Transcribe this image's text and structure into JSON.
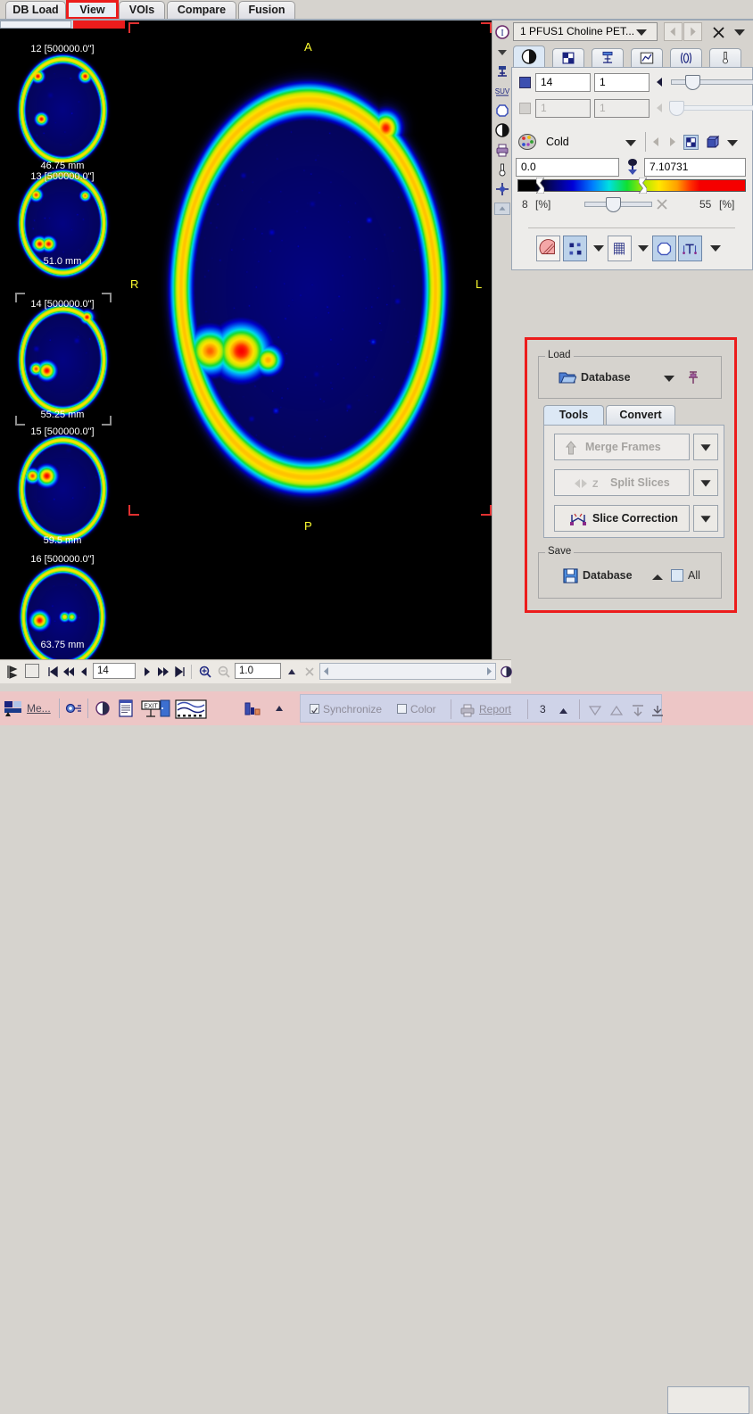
{
  "tabs": [
    {
      "label": "DB Load",
      "selected": false
    },
    {
      "label": "View",
      "selected": true,
      "highlighted": true
    },
    {
      "label": "VOIs",
      "selected": false
    },
    {
      "label": "Compare",
      "selected": false
    },
    {
      "label": "Fusion",
      "selected": false
    }
  ],
  "thumbnails": [
    {
      "index": "12 [500000.0\"]",
      "position": "46.75 mm"
    },
    {
      "index": "13 [500000.0\"]",
      "position": "51.0 mm"
    },
    {
      "index": "14 [500000.0\"]",
      "position": "55.25 mm",
      "selected": true
    },
    {
      "index": "15 [500000.0\"]",
      "position": "59.5 mm"
    },
    {
      "index": "16 [500000.0\"]",
      "position": "63.75 mm"
    }
  ],
  "main_view": {
    "orientation": {
      "top": "A",
      "left": "R",
      "right": "L",
      "bottom": "P"
    }
  },
  "series": {
    "name": "1 PFUS1 Choline PET...",
    "dropdown_icon": "chevron-down-icon",
    "prev_icon": "triangle-left-icon",
    "next_icon": "triangle-right-icon",
    "close_icon": "close-x-icon",
    "menu_icon": "chevron-down-icon"
  },
  "control_tabs": [
    {
      "name": "contrast-tab",
      "icon": "contrast-circle-icon",
      "selected": true
    },
    {
      "name": "layout-tab",
      "icon": "grid-layout-icon",
      "selected": false
    },
    {
      "name": "isocontour-tab",
      "icon": "isocontour-icon",
      "selected": false
    },
    {
      "name": "curve-tab",
      "icon": "chart-curve-icon",
      "selected": false
    },
    {
      "name": "kinetics-tab",
      "icon": "wave-icon",
      "selected": false
    },
    {
      "name": "probe-tab",
      "icon": "thermometer-icon",
      "selected": false
    }
  ],
  "slice_controls": {
    "row1": {
      "slice": "14",
      "frame": "1",
      "enabled": true
    },
    "row2": {
      "slice": "1",
      "frame": "1",
      "enabled": false
    }
  },
  "colortable": {
    "name": "Cold",
    "palette_icon": "color-palette-icon",
    "min_value": "0.0",
    "max_value": "7.10731",
    "lower_percent": "8",
    "lower_unit": "[%]",
    "upper_percent": "55",
    "upper_unit": "[%]",
    "threshold_icon": "threshold-icon",
    "clear_icon": "close-x-icon"
  },
  "display_buttons": [
    {
      "name": "hatch-overlay-button",
      "icon": "hatched-circle-icon",
      "active": false
    },
    {
      "name": "markers-button",
      "icon": "scatter-markers-icon",
      "active": true
    },
    {
      "name": "grid-button",
      "icon": "fine-grid-icon",
      "active": false
    },
    {
      "name": "contour-button",
      "icon": "octagon-outline-icon",
      "active": true
    },
    {
      "name": "annotate-button",
      "icon": "text-annotate-icon",
      "active": true
    }
  ],
  "load_panel": {
    "highlighted": true,
    "load": {
      "legend": "Load",
      "button_label": "Database",
      "button_icon": "open-folder-icon",
      "dropdown_icon": "chevron-down-icon",
      "pin_icon": "pushpin-icon"
    },
    "tabs": [
      {
        "label": "Tools",
        "selected": true
      },
      {
        "label": "Convert",
        "selected": false
      }
    ],
    "tools": [
      {
        "label": "Merge Frames",
        "icon": "merge-arrows-icon",
        "enabled": false
      },
      {
        "label": "Split Slices",
        "icon": "split-z-icon",
        "enabled": false
      },
      {
        "label": "Slice Correction",
        "icon": "slice-correction-icon",
        "enabled": true
      }
    ],
    "save": {
      "legend": "Save",
      "button_label": "Database",
      "button_icon": "floppy-disk-icon",
      "dropdown_icon": "chevron-up-icon",
      "all_label": "All",
      "all_checked": false
    }
  },
  "navbar": {
    "slice_value": "14",
    "zoom_value": "1.0",
    "icons": [
      "movie-play-icon",
      "stop-square-icon",
      "first-frame-icon",
      "prev-fast-icon",
      "prev-icon",
      "next-icon",
      "next-fast-icon",
      "last-frame-icon",
      "zoom-in-icon",
      "zoom-out-icon",
      "spin-up-icon",
      "close-x-icon"
    ]
  },
  "statusbar": {
    "menu_label": "Me...",
    "icons": [
      "layout-thumb-icon",
      "settings-gear-icon",
      "contrast-icon",
      "report-page-icon",
      "exit-door-icon",
      "film-strip-icon",
      "histogram-icon",
      "spin-up-icon"
    ],
    "synchronize_label": "Synchronize",
    "synchronize_checked": true,
    "color_label": "Color",
    "color_checked": false,
    "report_label": "Report",
    "report_icon": "printer-icon",
    "count_value": "3",
    "count_spinner_icon": "spin-up-icon",
    "right_icons": [
      "down-triangle-icon",
      "up-triangle-icon",
      "align-top-icon",
      "align-bottom-icon"
    ]
  },
  "colors": {
    "accent_red": "#ec1c1c",
    "tab_selected": "#dce8f5",
    "panel_bg": "#d6d3ce",
    "statusbar_bg": "#edc6c6",
    "sync_group_bg": "#cfd3e8"
  }
}
